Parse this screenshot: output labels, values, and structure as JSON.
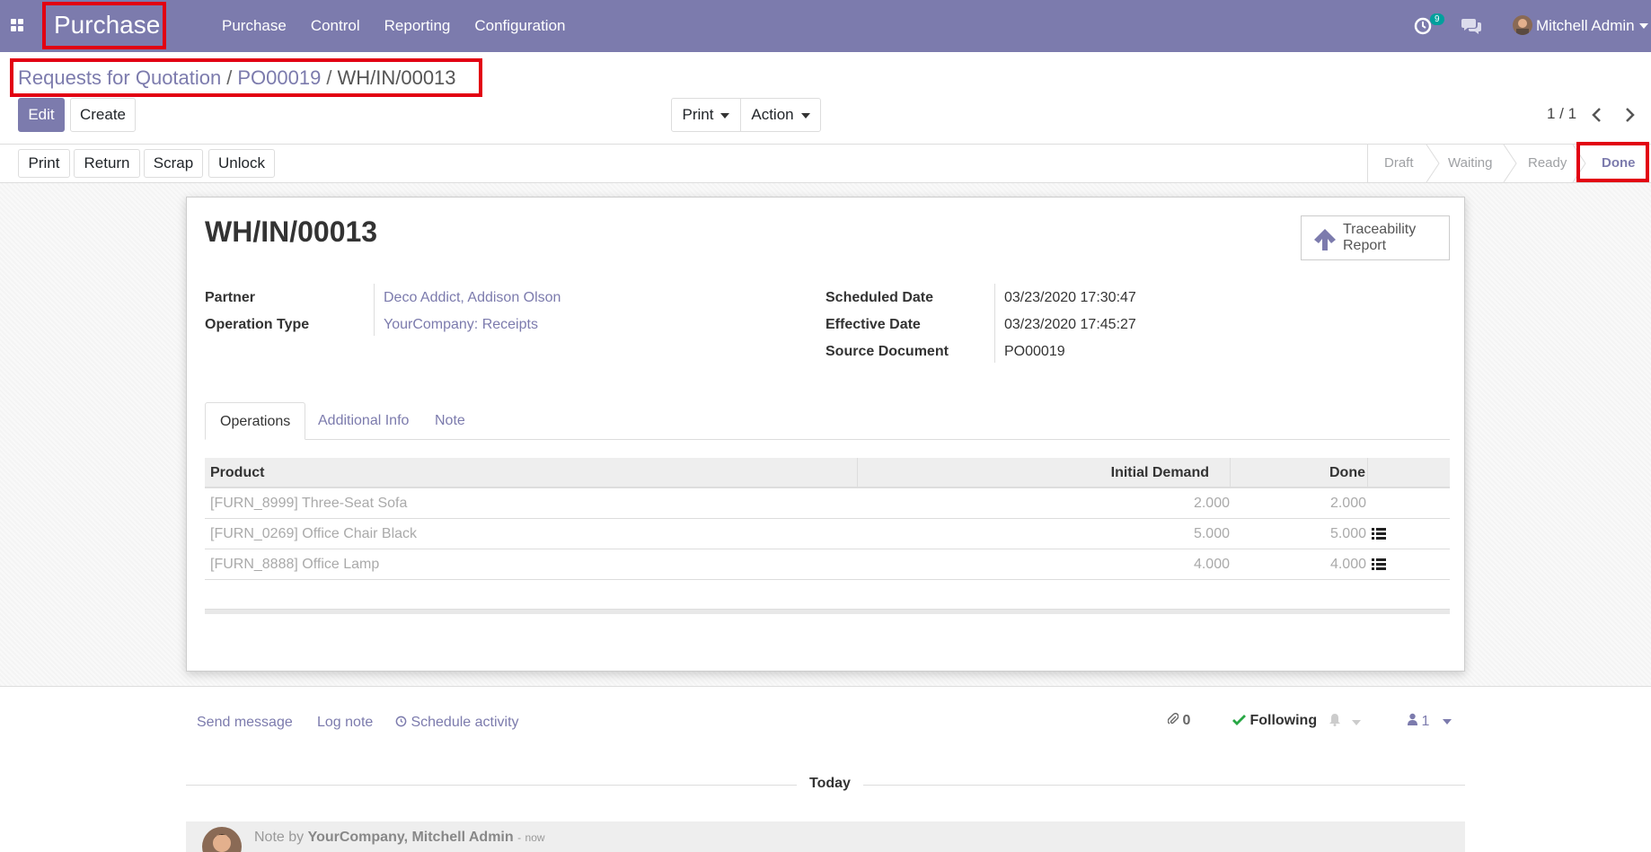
{
  "navbar": {
    "app_name": "Purchase",
    "menu": [
      "Purchase",
      "Control",
      "Reporting",
      "Configuration"
    ],
    "activity_count": "9",
    "user": "Mitchell Admin"
  },
  "breadcrumb": {
    "items": [
      "Requests for Quotation",
      "PO00019"
    ],
    "current": "WH/IN/00013",
    "separator": "/"
  },
  "control_panel": {
    "edit_label": "Edit",
    "create_label": "Create",
    "print_label": "Print",
    "action_label": "Action",
    "pager": "1 / 1"
  },
  "statusbar": {
    "buttons": [
      "Print",
      "Return",
      "Scrap",
      "Unlock"
    ],
    "stages": [
      "Draft",
      "Waiting",
      "Ready",
      "Done"
    ],
    "current_stage": "Done"
  },
  "record": {
    "title": "WH/IN/00013",
    "traceability_label": "Traceability Report",
    "partner_label": "Partner",
    "partner": "Deco Addict, Addison Olson",
    "operation_type_label": "Operation Type",
    "operation_type": "YourCompany: Receipts",
    "scheduled_date_label": "Scheduled Date",
    "scheduled_date": "03/23/2020 17:30:47",
    "effective_date_label": "Effective Date",
    "effective_date": "03/23/2020 17:45:27",
    "source_document_label": "Source Document",
    "source_document": "PO00019"
  },
  "tabs": [
    "Operations",
    "Additional Info",
    "Note"
  ],
  "operations": {
    "columns": [
      "Product",
      "Initial Demand",
      "Done"
    ],
    "rows": [
      {
        "product": "[FURN_8999] Three-Seat Sofa",
        "initial_demand": "2.000",
        "done": "2.000"
      },
      {
        "product": "[FURN_0269] Office Chair Black",
        "initial_demand": "5.000",
        "done": "5.000"
      },
      {
        "product": "[FURN_8888] Office Lamp",
        "initial_demand": "4.000",
        "done": "4.000"
      }
    ]
  },
  "chatter": {
    "send_message": "Send message",
    "log_note": "Log note",
    "schedule_activity": "Schedule activity",
    "attachments": "0",
    "following": "Following",
    "followers": "1",
    "today": "Today",
    "note_prefix": "Note by",
    "note_author": "YourCompany, Mitchell Admin",
    "note_time": "now"
  }
}
